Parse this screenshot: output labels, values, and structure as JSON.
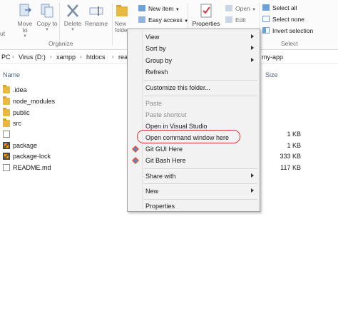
{
  "ribbon": {
    "move_to": "Move to",
    "copy_to": "Copy to",
    "delete": "Delete",
    "rename": "Rename",
    "new_folder": "New folder",
    "new_item": "New item",
    "easy_access": "Easy access",
    "properties": "Properties",
    "open": "Open",
    "edit": "Edit",
    "select_all": "Select all",
    "select_none": "Select none",
    "invert_selection": "Invert selection",
    "group_organize": "Organize",
    "group_select": "Select",
    "left_edge_label": "ut"
  },
  "address": {
    "segments": [
      "PC",
      "Virus (D:)",
      "xampp",
      "htdocs",
      "rea"
    ],
    "tail": "my-app"
  },
  "columns": {
    "name": "Name",
    "size": "Size"
  },
  "files": [
    {
      "name": ".idea",
      "type": "folder",
      "size": ""
    },
    {
      "name": "node_modules",
      "type": "folder",
      "size": ""
    },
    {
      "name": "public",
      "type": "folder",
      "size": ""
    },
    {
      "name": "src",
      "type": "folder",
      "size": ""
    },
    {
      "name": "",
      "type": "blank",
      "size": "1 KB"
    },
    {
      "name": "package",
      "type": "sublime",
      "size": "1 KB"
    },
    {
      "name": "package-lock",
      "type": "sublime",
      "size": "333 KB"
    },
    {
      "name": "README.md",
      "type": "blank",
      "size": "117 KB"
    }
  ],
  "context_menu": {
    "view": "View",
    "sort_by": "Sort by",
    "group_by": "Group by",
    "refresh": "Refresh",
    "customize": "Customize this folder...",
    "paste": "Paste",
    "paste_shortcut": "Paste shortcut",
    "open_vs": "Open in Visual Studio",
    "open_cmd": "Open command window here",
    "git_gui": "Git GUI Here",
    "git_bash": "Git Bash Here",
    "share_with": "Share with",
    "new": "New",
    "properties": "Properties"
  },
  "colors": {
    "highlight_ring": "#d9383a",
    "folder": "#e8b840",
    "menu_bg": "#f2f2f2"
  }
}
